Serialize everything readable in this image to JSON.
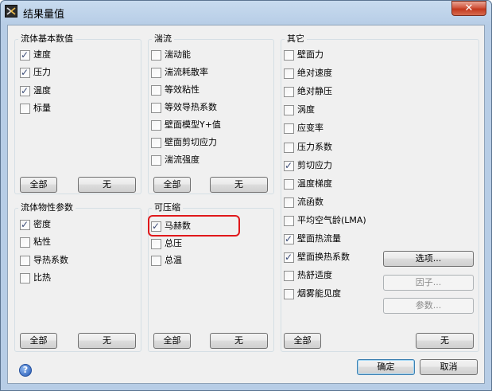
{
  "window": {
    "title": "结果量值",
    "close_glyph": "✕"
  },
  "groups": {
    "basic": {
      "title": "流体基本数值",
      "items": [
        {
          "label": "速度",
          "checked": true
        },
        {
          "label": "压力",
          "checked": true
        },
        {
          "label": "温度",
          "checked": true
        },
        {
          "label": "标量",
          "checked": false
        }
      ],
      "all_label": "全部",
      "none_label": "无"
    },
    "turb": {
      "title": "湍流",
      "items": [
        {
          "label": "湍动能",
          "checked": false
        },
        {
          "label": "湍流耗散率",
          "checked": false
        },
        {
          "label": "等效粘性",
          "checked": false
        },
        {
          "label": "等效导热系数",
          "checked": false
        },
        {
          "label": "壁面模型Y+值",
          "checked": false
        },
        {
          "label": "壁面剪切应力",
          "checked": false
        },
        {
          "label": "湍流强度",
          "checked": false
        }
      ],
      "all_label": "全部",
      "none_label": "无"
    },
    "other": {
      "title": "其它",
      "items": [
        {
          "label": "壁面力",
          "checked": false
        },
        {
          "label": "绝对速度",
          "checked": false
        },
        {
          "label": "绝对静压",
          "checked": false
        },
        {
          "label": "涡度",
          "checked": false
        },
        {
          "label": "应变率",
          "checked": false
        },
        {
          "label": "压力系数",
          "checked": false
        },
        {
          "label": "剪切应力",
          "checked": true
        },
        {
          "label": "温度梯度",
          "checked": false
        },
        {
          "label": "流函数",
          "checked": false
        },
        {
          "label": "平均空气龄(LMA)",
          "checked": false
        },
        {
          "label": "壁面热流量",
          "checked": true
        },
        {
          "label": "壁面换热系数",
          "checked": true
        },
        {
          "label": "热舒适度",
          "checked": false
        },
        {
          "label": "烟雾能见度",
          "checked": false
        }
      ],
      "options_label": "选项...",
      "factor_label": "因子...",
      "params_label": "参数...",
      "all_label": "全部",
      "none_label": "无"
    },
    "props": {
      "title": "流体物性参数",
      "items": [
        {
          "label": "密度",
          "checked": true
        },
        {
          "label": "粘性",
          "checked": false
        },
        {
          "label": "导热系数",
          "checked": false
        },
        {
          "label": "比热",
          "checked": false
        }
      ],
      "all_label": "全部",
      "none_label": "无"
    },
    "comp": {
      "title": "可压缩",
      "items": [
        {
          "label": "马赫数",
          "checked": true
        },
        {
          "label": "总压",
          "checked": false
        },
        {
          "label": "总温",
          "checked": false
        }
      ],
      "all_label": "全部",
      "none_label": "无"
    }
  },
  "footer": {
    "help_glyph": "?",
    "ok_label": "确定",
    "cancel_label": "取消"
  }
}
